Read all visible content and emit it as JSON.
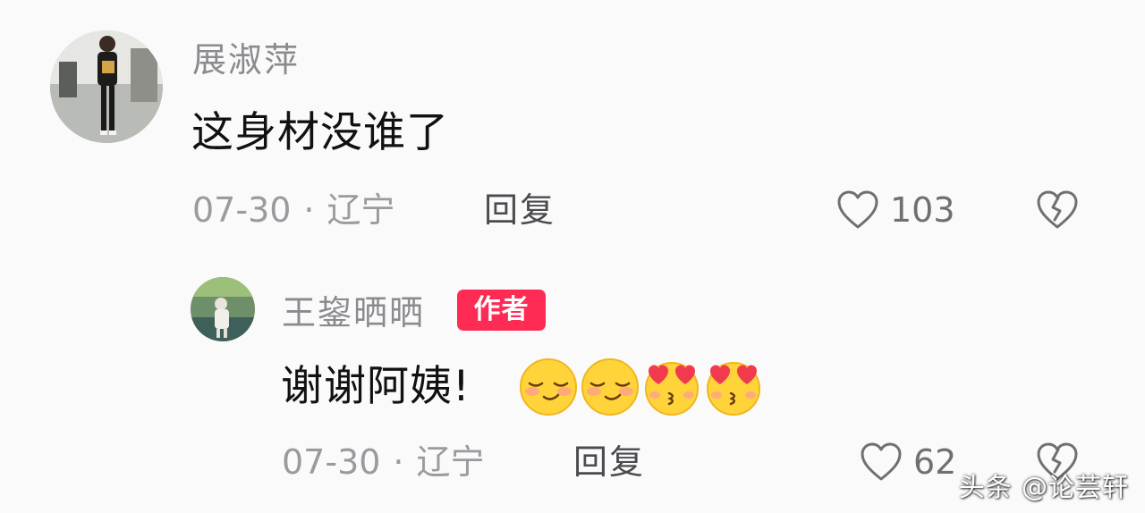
{
  "comment": {
    "username": "展淑萍",
    "text": "这身材没谁了",
    "date": "07-30",
    "separator": "·",
    "location": "辽宁",
    "reply_label": "回复",
    "like_count": "103"
  },
  "reply": {
    "username": "王鋆晒晒",
    "badge": "作者",
    "text": "谢谢阿姨!",
    "emojis": [
      "shy-smile-emoji",
      "shy-smile-emoji",
      "heart-eyes-kiss-emoji",
      "heart-eyes-kiss-emoji"
    ],
    "date": "07-30",
    "separator": "·",
    "location": "辽宁",
    "reply_label": "回复",
    "like_count": "62"
  },
  "watermark": "头条 @论芸轩",
  "colors": {
    "background": "#fafafa",
    "badge": "#fe2c55",
    "username": "#8a8a8f",
    "meta": "#9a9a9f",
    "text": "#111111"
  }
}
